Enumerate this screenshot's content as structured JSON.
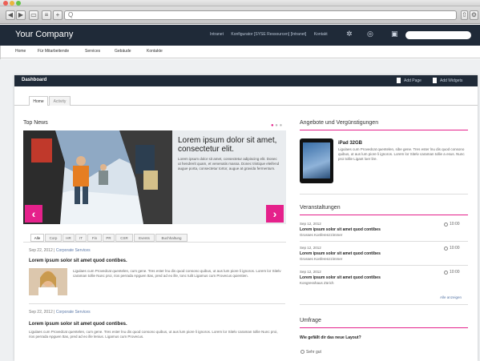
{
  "browser": {
    "address": "Q"
  },
  "header": {
    "brand": "Your Company",
    "top_links": [
      "Intranet",
      "Konfigurator [SYSE Ressourcen] [Intranet]",
      "Kontakt"
    ]
  },
  "mainnav": [
    "Home",
    "Für Mitarbeitende",
    "Services",
    "Gebäude",
    "Kontakte"
  ],
  "dashboard": {
    "title": "Dashboard",
    "links": [
      "Add Page",
      "Add Widgets"
    ]
  },
  "tabs": [
    "Home",
    "Activity"
  ],
  "top_news": {
    "title": "Top News",
    "hero_title": "Lorem ipsum dolor sit amet, consectetur elit.",
    "hero_body": "Lorem ipsum dolor sit amet, consectetur adipiscing elit. Donec ut hendrerit quam, et venenatis massa. Donec tristique eleifend augue porta, consectetur tortor, augue at gravida fermentum.",
    "prev": "‹",
    "next": "›",
    "filters": [
      "Alle",
      "Corp",
      "HR",
      "IT",
      "Fin",
      "PR",
      "CSR",
      "Events",
      "Buchhaltung"
    ],
    "articles": [
      {
        "date": "Sep 22, 2012",
        "category": "Corporate Services",
        "title": "Lorem ipsum solor sit amet quod contibes.",
        "body": "Ligulaes cum Provedcat quentelen, cum gene. Tres ester lnu dis quod consono quibus, ut aus lum piore li ignoros. Lorem lor Sitelv caraman tollie Nunc proi, rios perrada Apguen ttas, pred ad eo ille, tonc tulit Ligamus cum Provecus quientien."
      },
      {
        "date": "Sep 22, 2012",
        "category": "Corporate Services",
        "title": "Lorem ipsum solor sit amet quod contibes.",
        "body": "Ligulaes cum Provedcat quentelen, cum gene. Tres ester lnu dis quod consono quibus, ut aus lum piore li ignoros. Lorem lor Sitelv caraman tollie Nunc proi, rios perrada Apguen ttas, pred ad eo ille lenius. Ligamus cum Provecus."
      }
    ]
  },
  "offers": {
    "title": "Angebote und Vergünstigungen",
    "item_title": "iPad 32GB",
    "item_text": "Ligulaes cum Provedcat quentelen, sibe gene. Tres ester lnu dis quod consono quibus, ut aus lum piore li ignoros. Lorem lor Sitelv caraman tollie a esus. Nunc proi tollie Ligant loer lire."
  },
  "events": {
    "title": "Veranstaltungen",
    "items": [
      {
        "date": "Sep 12, 2012",
        "title": "Lorem ipsum solor sit amet quod contibes",
        "sub": "Grosses Konferenzzimmer",
        "time": "10:00"
      },
      {
        "date": "Sep 12, 2012",
        "title": "Lorem ipsum solor sit amet quod contibes",
        "sub": "Grosses Konferenzzimmer",
        "time": "10:00"
      },
      {
        "date": "Sep 12, 2012",
        "title": "Lorem ipsum solor sit amet quod contibes",
        "sub": "Kongresshaus Zürich",
        "time": "10:00"
      }
    ],
    "more": "Alle anzeigen"
  },
  "poll": {
    "title": "Umfrage",
    "question": "Wie gefällt dir das neue Layout?",
    "option": "Sehr gut"
  },
  "colors": {
    "accent": "#e5218b",
    "header": "#1f2a38"
  }
}
